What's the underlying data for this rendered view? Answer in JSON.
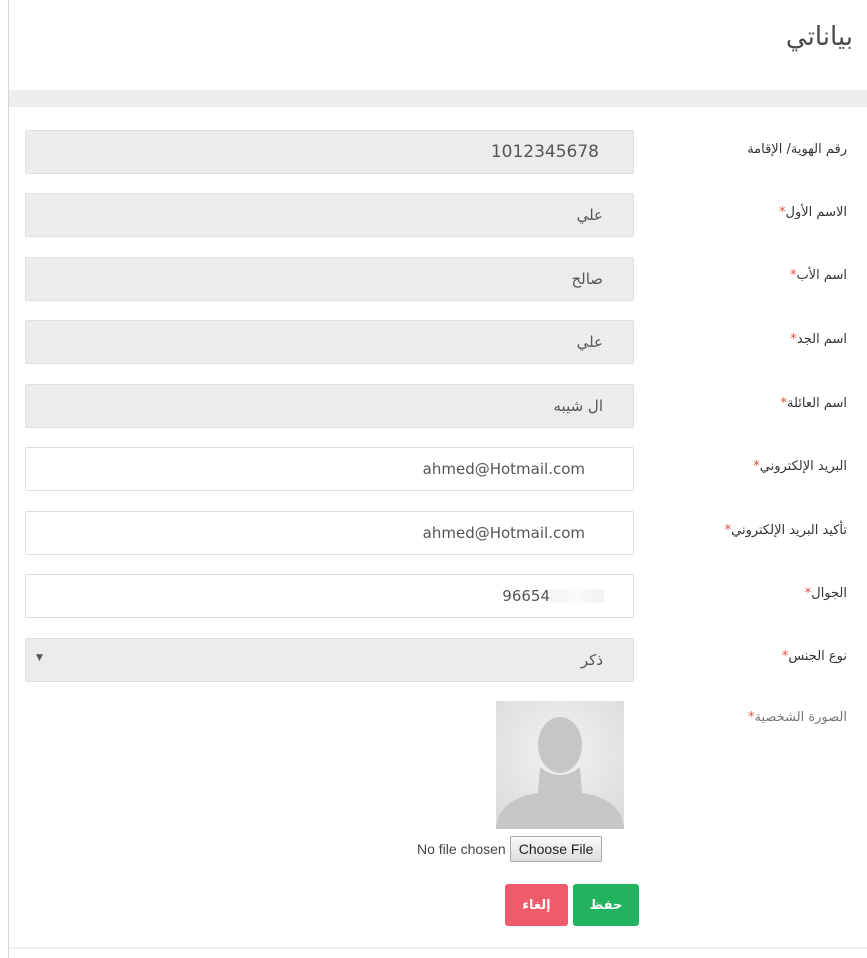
{
  "page": {
    "title": "بياناتي"
  },
  "form": {
    "fields": [
      {
        "label": "رقم الهوية/ الإقامة",
        "required": false,
        "value": "1012345678"
      },
      {
        "label": "الاسم الأول",
        "required": true,
        "value": "علي"
      },
      {
        "label": "اسم الأب",
        "required": true,
        "value": "صالح"
      },
      {
        "label": "اسم الجد",
        "required": true,
        "value": "علي"
      },
      {
        "label": "اسم العائلة",
        "required": true,
        "value": "ال شيبه"
      },
      {
        "label": "البريد الإلكتروني",
        "required": true,
        "value": "ahmed@Hotmail.com"
      },
      {
        "label": "تأكيد البريد الإلكتروني",
        "required": true,
        "value": "ahmed@Hotmail.com"
      },
      {
        "label": "الجوال",
        "required": true,
        "value": "96654"
      },
      {
        "label": "نوع الجنس",
        "required": true,
        "value": "ذكر"
      },
      {
        "label": "الصورة الشخصية",
        "required": true
      }
    ],
    "required_mark": "*",
    "file": {
      "status": "No file chosen",
      "button": "Choose File"
    },
    "buttons": {
      "save": "حفظ",
      "cancel": "إلغاء"
    }
  },
  "colors": {
    "save": "#22b35e",
    "cancel": "#ef5b6a",
    "required": "#e84c3d"
  },
  "icons": {
    "select": "caret-down-icon",
    "avatar": "avatar-placeholder-icon"
  }
}
